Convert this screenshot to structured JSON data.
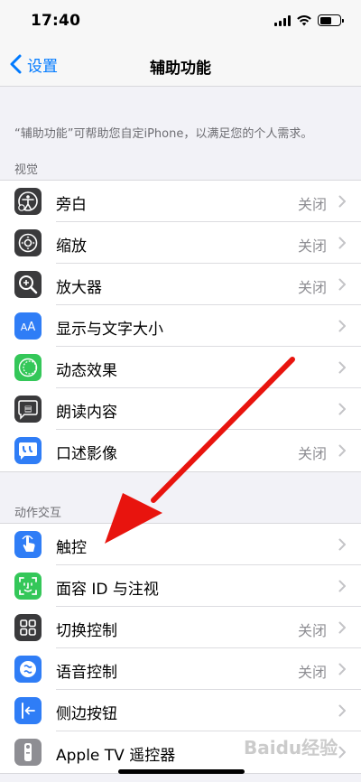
{
  "status_bar": {
    "time": "17:40"
  },
  "nav": {
    "back_label": "设置",
    "title": "辅助功能"
  },
  "description": "“辅助功能”可帮助您自定iPhone，以满足您的个人需求。",
  "sections": [
    {
      "header": "视觉",
      "items": [
        {
          "label": "旁白",
          "value": "关闭",
          "icon": "voiceover-icon",
          "color": "#3a3a3c"
        },
        {
          "label": "缩放",
          "value": "关闭",
          "icon": "zoom-icon",
          "color": "#3a3a3c"
        },
        {
          "label": "放大器",
          "value": "关闭",
          "icon": "magnifier-icon",
          "color": "#3a3a3c"
        },
        {
          "label": "显示与文字大小",
          "value": "",
          "icon": "text-size-icon",
          "color": "#2f7df6"
        },
        {
          "label": "动态效果",
          "value": "",
          "icon": "motion-icon",
          "color": "#34c759"
        },
        {
          "label": "朗读内容",
          "value": "",
          "icon": "spoken-content-icon",
          "color": "#3a3a3c"
        },
        {
          "label": "口述影像",
          "value": "关闭",
          "icon": "audio-description-icon",
          "color": "#2f7df6"
        }
      ]
    },
    {
      "header": "动作交互",
      "items": [
        {
          "label": "触控",
          "value": "",
          "icon": "touch-icon",
          "color": "#2f7df6"
        },
        {
          "label": "面容 ID 与注视",
          "value": "",
          "icon": "face-id-icon",
          "color": "#34c759"
        },
        {
          "label": "切换控制",
          "value": "关闭",
          "icon": "switch-control-icon",
          "color": "#3a3a3c"
        },
        {
          "label": "语音控制",
          "value": "关闭",
          "icon": "voice-control-icon",
          "color": "#2f7df6"
        },
        {
          "label": "侧边按钮",
          "value": "",
          "icon": "side-button-icon",
          "color": "#2f7df6"
        },
        {
          "label": "Apple TV 遥控器",
          "value": "",
          "icon": "apple-tv-remote-icon",
          "color": "#8e8e93"
        }
      ]
    }
  ],
  "colors": {
    "accent": "#007aff",
    "annotation_arrow": "#e8140e",
    "background": "#f2f2f7"
  },
  "watermark": "Baidu经验"
}
